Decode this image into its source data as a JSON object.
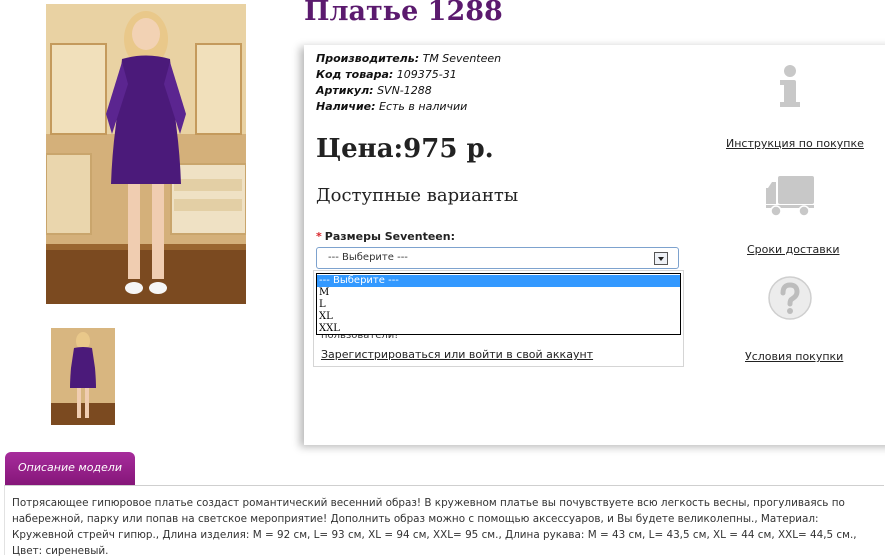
{
  "product": {
    "title": "Платье 1288",
    "photo_alt": "Платье 1288"
  },
  "info": {
    "manufacturer_label": "Производитель:",
    "manufacturer_value": "TM Seventeen",
    "code_label": "Код товара:",
    "code_value": "109375-31",
    "sku_label": "Артикул:",
    "sku_value": "SVN-1288",
    "stock_label": "Наличие:",
    "stock_value": "Есть в наличии"
  },
  "price_text": "Цена:975 р.",
  "variants_heading": "Доступные варианты",
  "size": {
    "required_mark": "*",
    "label": "Размеры Seventeen:",
    "selected": "--- Выберите ---",
    "options": [
      "--- Выберите ---",
      "M",
      "L",
      "XL",
      "XXL"
    ]
  },
  "login": {
    "text_tail": "пользователи!",
    "register_link": "Зарегистрироваться или войти в свой аккаунт"
  },
  "sidebar": {
    "instructions_link": "Инструкция по покупке",
    "delivery_link": "Сроки доставки",
    "terms_link": "Условия покупки"
  },
  "tabs": {
    "description_label": "Описание модели"
  },
  "description": "Потрясающее гипюровое платье создаст романтический весенний образ! В кружевном платье вы почувствуете всю легкость весны, прогуливаясь по набережной, парку или попав на светское мероприятие! Дополнить образ можно с помощью аксессуаров, и Вы будете великолепны., Материал: Кружевной стрейч гипюр., Длина изделия: M = 92 см, L= 93 см, XL = 94 см, XXL= 95 см., Длина рукава: M = 43 см, L= 43,5 см, XL = 44 см, XXL= 44,5 см., Цвет: сиреневый.",
  "colors": {
    "title": "#5b1a6e",
    "tab": "#941d86",
    "dress": "#4b1a7a",
    "select_highlight": "#3399ff",
    "required": "#d8262b"
  }
}
